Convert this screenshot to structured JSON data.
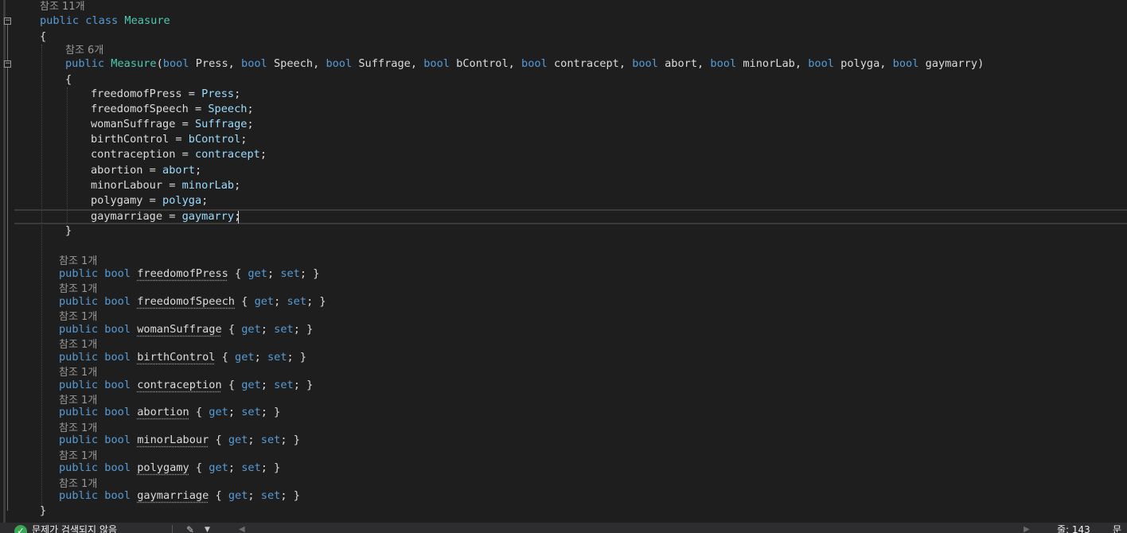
{
  "editor": {
    "ref_11": "참조 11개",
    "ref_6": "참조 6개",
    "ref_1": "참조 1개",
    "kw_public": "public",
    "kw_class": "class",
    "kw_bool": "bool",
    "kw_get": "get",
    "kw_set": "set",
    "class_name": "Measure",
    "brace_open": "{",
    "brace_close": "}",
    "params": [
      "Press",
      "Speech",
      "Suffrage",
      "bControl",
      "contracept",
      "abort",
      "minorLab",
      "polyga",
      "gaymarry"
    ],
    "fields": [
      "freedomofPress",
      "freedomofSpeech",
      "womanSuffrage",
      "birthControl",
      "contraception",
      "abortion",
      "minorLabour",
      "polygamy",
      "gaymarriage"
    ]
  },
  "status_bar": {
    "ok_icon": "check-circle-icon",
    "issues_text": "문제가 검색되지 않음",
    "line_label": "줄: 143",
    "col_label": "문자"
  },
  "colors": {
    "background": "#1e1e1e",
    "keyword": "#569cd6",
    "type": "#4ec9b0",
    "parameter": "#9cdcfe",
    "plain": "#dcdcdc",
    "codelens": "#999999"
  }
}
